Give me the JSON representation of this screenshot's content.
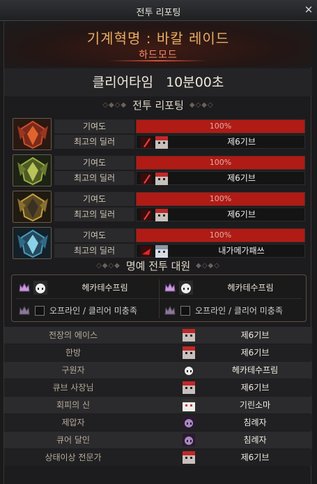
{
  "window": {
    "title": "전투 리포팅"
  },
  "header": {
    "raid_name": "기계혁명 : 바칼 레이드",
    "mode": "하드모드"
  },
  "clear": {
    "label": "클리어타임",
    "time": "10분00초"
  },
  "report": {
    "heading": "전투 리포팅",
    "members": [
      {
        "contribution_label": "기여도",
        "contribution": "100%",
        "contribution_value": 100,
        "best_dealer_label": "최고의 딜러",
        "best_dealer": "제6기브",
        "portrait": "red-boss-portrait-icon"
      },
      {
        "contribution_label": "기여도",
        "contribution": "100%",
        "contribution_value": 100,
        "best_dealer_label": "최고의 딜러",
        "best_dealer": "제6기브",
        "portrait": "green-boss-portrait-icon"
      },
      {
        "contribution_label": "기여도",
        "contribution": "100%",
        "contribution_value": 100,
        "best_dealer_label": "최고의 딜러",
        "best_dealer": "제6기브",
        "portrait": "gold-boss-portrait-icon"
      },
      {
        "contribution_label": "기여도",
        "contribution": "100%",
        "contribution_value": 100,
        "best_dealer_label": "최고의 딜러",
        "best_dealer": "내가메가패쓰",
        "portrait": "blue-boss-portrait-icon"
      }
    ]
  },
  "honor": {
    "heading": "명예 전투 대원",
    "entries": [
      {
        "name": "헤카테수프림"
      },
      {
        "name": "헤카테수프림"
      },
      {
        "name": "오프라인 / 클리어 미충족"
      },
      {
        "name": "오프라인 / 클리어 미충족"
      }
    ]
  },
  "titles": [
    {
      "title": "전장의 에이스",
      "player": "제6기브"
    },
    {
      "title": "한방",
      "player": "제6기브"
    },
    {
      "title": "구원자",
      "player": "헤카테수프림"
    },
    {
      "title": "큐브 사장님",
      "player": "제6기브"
    },
    {
      "title": "회피의 신",
      "player": "기린소마"
    },
    {
      "title": "제압자",
      "player": "침례자"
    },
    {
      "title": "큐어 달인",
      "player": "침례자"
    },
    {
      "title": "상태이상 전문가",
      "player": "제6기브"
    }
  ],
  "colors": {
    "accent_gold": "#e8ad62",
    "hard_mode": "#ff8a63",
    "bar_red": "#b01b16"
  }
}
